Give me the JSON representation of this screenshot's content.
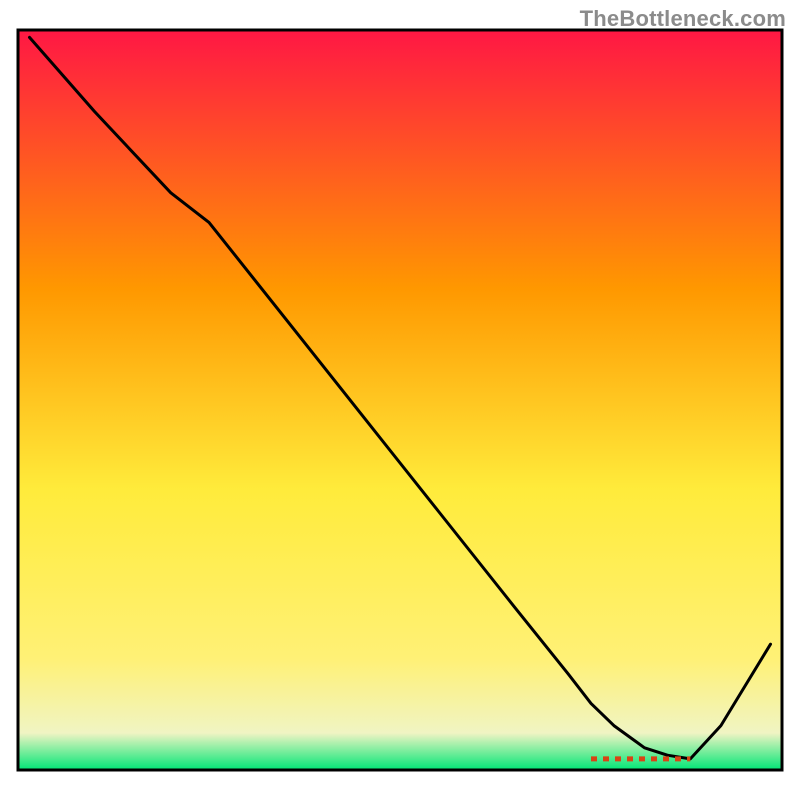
{
  "watermark": "TheBottleneck.com",
  "chart_data": {
    "type": "line",
    "title": "",
    "xlabel": "",
    "ylabel": "",
    "xlim": [
      0,
      100
    ],
    "ylim": [
      0,
      100
    ],
    "gradient_colors": {
      "top": "#ff1744",
      "upper_mid": "#ff9800",
      "mid": "#ffeb3b",
      "lower_mid": "#fff176",
      "near_bottom_pale": "#f0f4c3",
      "bottom": "#00e676"
    },
    "series": [
      {
        "name": "bottleneck-curve",
        "color": "#000000",
        "x": [
          1.5,
          10,
          20,
          25,
          35,
          45,
          55,
          65,
          72,
          75,
          78,
          82,
          85,
          88,
          92,
          98.5
        ],
        "values": [
          99,
          89,
          78,
          74,
          61,
          48,
          35,
          22,
          13,
          9,
          6,
          3,
          2,
          1.5,
          6,
          17
        ]
      }
    ],
    "annotation": {
      "name": "valley-marker",
      "x_start": 75,
      "x_end": 88,
      "y": 1.5,
      "color": "#d84315",
      "dash": [
        6,
        6
      ]
    }
  }
}
